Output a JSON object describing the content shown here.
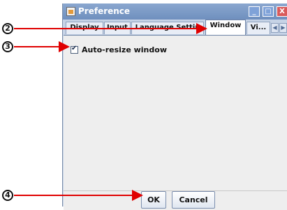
{
  "window": {
    "title": "Preference",
    "controls": {
      "minimize": "_",
      "maximize": "□",
      "close": "X"
    }
  },
  "tabs": [
    {
      "label": "Display"
    },
    {
      "label": "Input"
    },
    {
      "label": "Language Settin"
    },
    {
      "label": "Window"
    },
    {
      "label": "Vi..."
    }
  ],
  "tab_scroll": {
    "left": "◀",
    "right": "▶"
  },
  "content": {
    "checkbox_label": "Auto-resize window",
    "checked": true
  },
  "footer": {
    "ok_label": "OK",
    "cancel_label": "Cancel"
  },
  "callouts": [
    {
      "number": "2"
    },
    {
      "number": "3"
    },
    {
      "number": "4"
    }
  ],
  "colors": {
    "annotation": "#e00000",
    "titlebar": "#7f9ccb",
    "panel": "#eeeeee"
  }
}
